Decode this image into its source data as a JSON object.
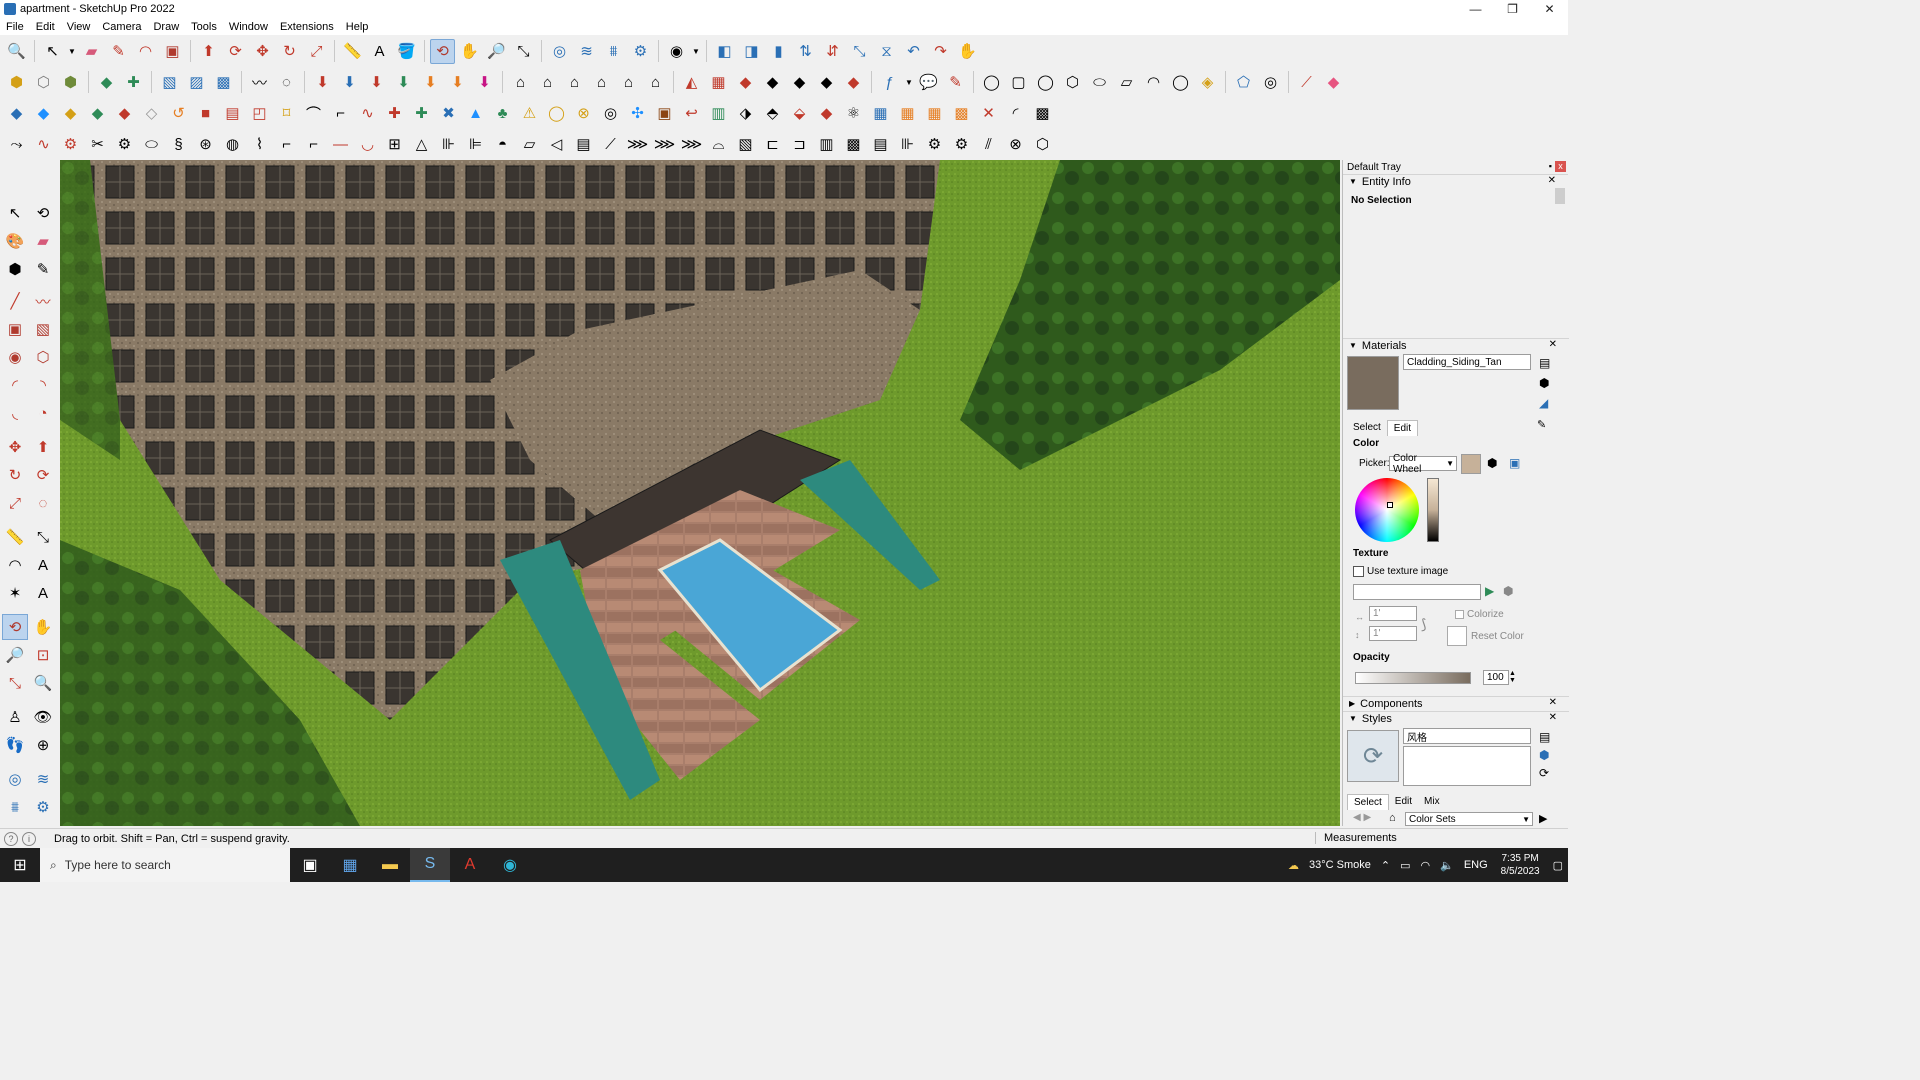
{
  "window": {
    "title": "apartment - SketchUp Pro 2022",
    "minimize": "—",
    "maximize": "❐",
    "close": "✕"
  },
  "menu": [
    "File",
    "Edit",
    "View",
    "Camera",
    "Draw",
    "Tools",
    "Window",
    "Extensions",
    "Help"
  ],
  "colors": {
    "accent": "#bcd4ee",
    "grass": "#6e9a2c",
    "building": "#8a7a66",
    "pool": "#4aa6d6",
    "taskbar": "#1f1f1f"
  },
  "tray": {
    "title": "Default Tray",
    "pin": "📌",
    "close": "x",
    "entity_info": {
      "header": "Entity Info",
      "selection": "No Selection"
    },
    "materials": {
      "header": "Materials",
      "material_name": "Cladding_Siding_Tan",
      "tabs": [
        "Select",
        "Edit"
      ],
      "color_label": "Color",
      "picker_label": "Picker:",
      "picker_value": "Color Wheel",
      "texture_label": "Texture",
      "use_texture": "Use texture image",
      "width_value": "1'",
      "height_value": "1'",
      "colorize": "Colorize",
      "reset_color": "Reset Color",
      "opacity_label": "Opacity",
      "opacity_value": "100",
      "swatch_color": "#796c5e"
    },
    "components": {
      "header": "Components"
    },
    "styles": {
      "header": "Styles",
      "style_name": "风格",
      "tabs": [
        "Select",
        "Edit",
        "Mix"
      ],
      "collection": "Color Sets"
    }
  },
  "status": {
    "message": "Drag to orbit. Shift = Pan, Ctrl = suspend gravity.",
    "measurements_label": "Measurements",
    "icon1": "?",
    "icon2": "i"
  },
  "taskbar": {
    "search_placeholder": "Type here to search",
    "weather": "33°C  Smoke",
    "language": "ENG",
    "time": "7:35 PM",
    "date": "8/5/2023"
  }
}
